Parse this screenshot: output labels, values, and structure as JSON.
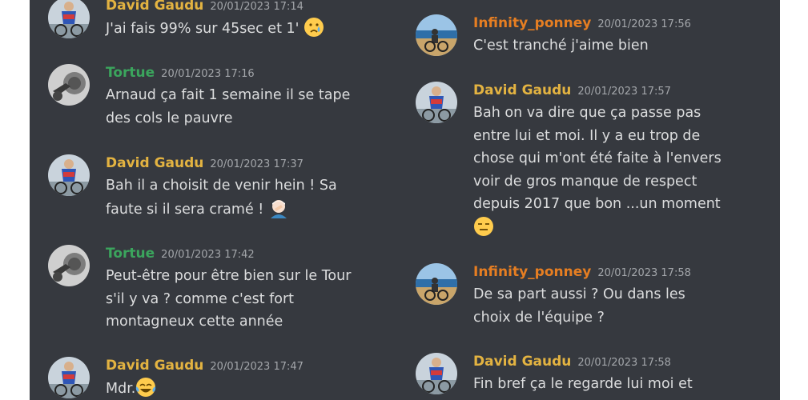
{
  "colors": {
    "background": "#36393f",
    "author_david": "#e3b341",
    "author_tortue": "#3ba55d",
    "author_infinity": "#e67e22",
    "message_text": "#dcddde",
    "timestamp_text": "#a3a6aa"
  },
  "left_column": {
    "messages": [
      {
        "author": "David Gaudu",
        "timestamp": "20/01/2023 17:14",
        "avatar_icon": "cyclist-avatar-icon",
        "lines": [
          "J'ai fais 99% sur 45sec et 1'"
        ],
        "emoji": "crying-face-emoji"
      },
      {
        "author": "Tortue",
        "timestamp": "20/01/2023 17:16",
        "avatar_icon": "motorcycle-avatar-icon",
        "lines": [
          "Arnaud ça fait 1 semaine il se tape",
          "des cols le pauvre"
        ]
      },
      {
        "author": "David Gaudu",
        "timestamp": "20/01/2023 17:37",
        "avatar_icon": "cyclist-avatar-icon",
        "lines": [
          "Bah il a choisit de venir hein ! Sa",
          "faute si il sera cramé !"
        ],
        "emoji": "facepalm-emoji"
      },
      {
        "author": "Tortue",
        "timestamp": "20/01/2023 17:42",
        "avatar_icon": "motorcycle-avatar-icon",
        "lines": [
          "Peut-être pour être bien sur le Tour",
          "s'il y va ? comme c'est fort",
          "montagneux cette année"
        ]
      },
      {
        "author": "David Gaudu",
        "timestamp": "20/01/2023 17:47",
        "avatar_icon": "cyclist-avatar-icon",
        "lines": [
          "Mdr."
        ],
        "emoji": "tears-of-joy-emoji"
      }
    ]
  },
  "right_column": {
    "messages": [
      {
        "author": "Infinity_ponney",
        "timestamp": "20/01/2023 17:56",
        "avatar_icon": "beach-rider-avatar-icon",
        "lines": [
          "C'est tranché j'aime bien"
        ]
      },
      {
        "author": "David Gaudu",
        "timestamp": "20/01/2023 17:57",
        "avatar_icon": "cyclist-avatar-icon",
        "lines": [
          "Bah on va dire que ça passe pas",
          "entre lui et moi. Il y a eu trop de",
          "chose qui m'ont été faite à l'envers",
          "voir de gros manque de respect",
          "depuis 2017 que bon ...un moment"
        ],
        "emoji_line": "expressionless-face-emoji"
      },
      {
        "author": "Infinity_ponney",
        "timestamp": "20/01/2023 17:58",
        "avatar_icon": "beach-rider-avatar-icon",
        "lines": [
          "De sa part aussi ? Ou dans les",
          "choix de l'équipe ?"
        ]
      },
      {
        "author": "David Gaudu",
        "timestamp": "20/01/2023 17:58",
        "avatar_icon": "cyclist-avatar-icon",
        "lines": [
          "Fin bref ça le regarde lui moi et"
        ]
      }
    ]
  }
}
